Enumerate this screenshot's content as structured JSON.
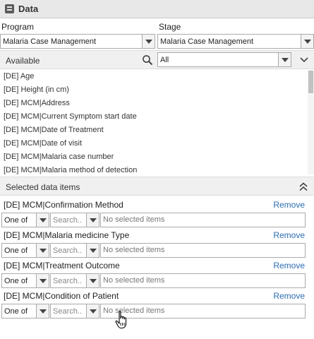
{
  "header": {
    "title": "Data",
    "icon": "data-table-icon"
  },
  "program": {
    "label": "Program",
    "value": "Malaria Case Management"
  },
  "stage": {
    "label": "Stage",
    "value": "Malaria Case Management"
  },
  "available": {
    "label": "Available",
    "filter_value": "All",
    "items": [
      "[DE] Age",
      "[DE] Height (in cm)",
      "[DE] MCM|Address",
      "[DE] MCM|Current Symptom start date",
      "[DE] MCM|Date of Treatment",
      "[DE] MCM|Date of visit",
      "[DE] MCM|Malaria case number",
      "[DE] MCM|Malaria method of detection"
    ]
  },
  "selected": {
    "title": "Selected data items",
    "remove_label": "Remove",
    "items": [
      {
        "name": "[DE] MCM|Confirmation Method",
        "operator": "One of",
        "search_placeholder": "Search..",
        "selection": "No selected items"
      },
      {
        "name": "[DE] MCM|Malaria medicine Type",
        "operator": "One of",
        "search_placeholder": "Search..",
        "selection": "No selected items"
      },
      {
        "name": "[DE] MCM|Treatment Outcome",
        "operator": "One of",
        "search_placeholder": "Search..",
        "selection": "No selected items"
      },
      {
        "name": "[DE] MCM|Condition of Patient",
        "operator": "One of",
        "search_placeholder": "Search..",
        "selection": "No selected items"
      }
    ]
  },
  "colors": {
    "link": "#2a6cb0",
    "panel_bg": "#f0f0f0",
    "header_bg": "#e8e8e8"
  }
}
